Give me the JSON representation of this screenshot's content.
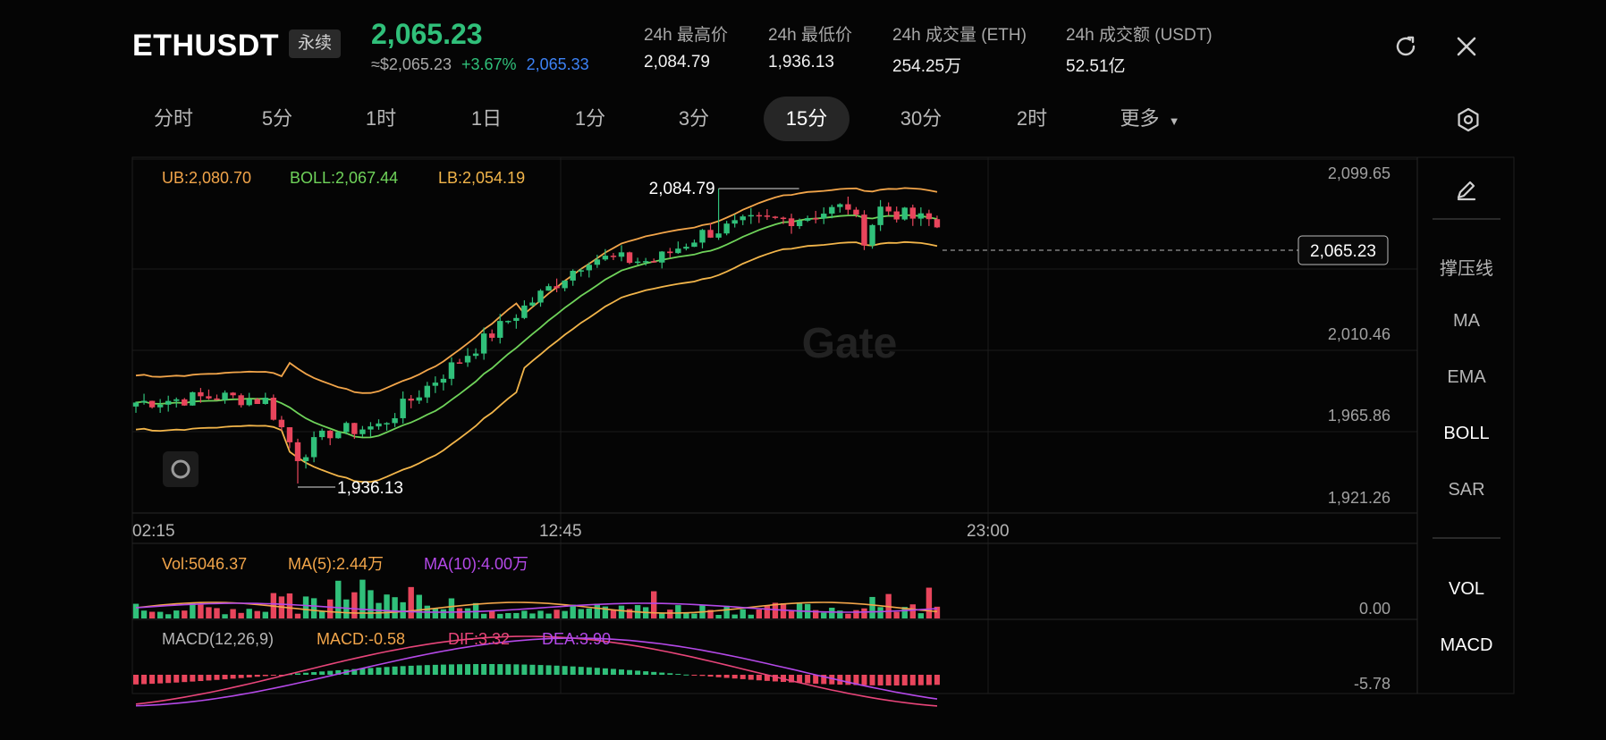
{
  "header": {
    "symbol": "ETHUSDT",
    "badge": "永续",
    "price": "2,065.23",
    "usd_price": "≈$2,065.23",
    "change": "+3.67%",
    "mark_price": "2,065.33",
    "stats": [
      {
        "label": "24h 最高价",
        "value": "2,084.79"
      },
      {
        "label": "24h 最低价",
        "value": "1,936.13"
      },
      {
        "label": "24h 成交量 (ETH)",
        "value": "254.25万"
      },
      {
        "label": "24h 成交额 (USDT)",
        "value": "52.51亿"
      }
    ]
  },
  "icons": {
    "refresh": "refresh-icon",
    "close": "close-icon",
    "settings": "hexagon-settings-icon",
    "draw": "pencil-icon",
    "logo": "gate-logo-icon"
  },
  "tabs": [
    "分时",
    "5分",
    "1时",
    "1日",
    "1分",
    "3分",
    "15分",
    "30分",
    "2时",
    "更多"
  ],
  "active_tab": "15分",
  "indicators": {
    "boll": {
      "ub": "UB:2,080.70",
      "boll": "BOLL:2,067.44",
      "lb": "LB:2,054.19"
    },
    "vol": {
      "vol": "Vol:5046.37",
      "ma5": "MA(5):2.44万",
      "ma10": "MA(10):4.00万"
    },
    "macd": {
      "name": "MACD(12,26,9)",
      "macd": "MACD:-0.58",
      "dif": "DIF:3.32",
      "dea": "DEA:3.90"
    }
  },
  "side_menu": [
    "撑压线",
    "MA",
    "EMA",
    "BOLL",
    "SAR",
    "VOL",
    "MACD"
  ],
  "colors": {
    "up": "#30c07a",
    "down": "#e8455c",
    "ub": "#f2a54a",
    "boll": "#6fd35a",
    "lb": "#f2b54a",
    "ma5": "#f2a54a",
    "ma10": "#b449e8",
    "dif": "#e8457a",
    "dea": "#b449e8",
    "mark": "#3d82f5"
  },
  "watermark": "Gate",
  "chart_data": {
    "type": "candlestick",
    "y_ticks": [
      "2,099.65",
      "2,010.46",
      "1,965.86",
      "1,921.26"
    ],
    "ylim": [
      1921.26,
      2099.65
    ],
    "x_ticks": [
      "02:15",
      "12:45",
      "23:00"
    ],
    "high_label": "2,084.79",
    "low_label": "1,936.13",
    "current_label": "2,065.23",
    "current": 2065.23,
    "high": 2084.79,
    "low": 1936.13,
    "vol_axis_label": "0.00",
    "macd_axis_label": "-5.78"
  }
}
